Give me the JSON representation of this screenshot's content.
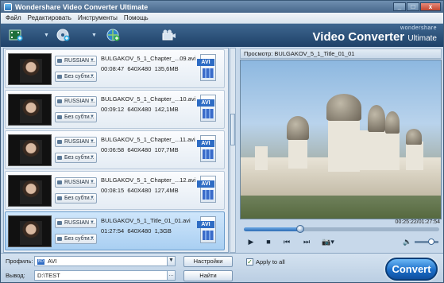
{
  "window": {
    "title": "Wondershare Video Converter Ultimate"
  },
  "menu": [
    "Файл",
    "Редактировать",
    "Инструменты",
    "Помощь"
  ],
  "brand": {
    "small": "wondershare",
    "big": "Video Converter",
    "suffix": "Ultimate"
  },
  "files": [
    {
      "name": "BULGAKOV_5_1_Chapter_...09.avi",
      "duration": "00:08:47",
      "resolution": "640X480",
      "size": "135,6MB",
      "audio": "RUSSIAN ...",
      "subtitle": "Без субти...",
      "format": "AVI",
      "selected": false
    },
    {
      "name": "BULGAKOV_5_1_Chapter_...10.avi",
      "duration": "00:09:12",
      "resolution": "640X480",
      "size": "142,1MB",
      "audio": "RUSSIAN ...",
      "subtitle": "Без субти...",
      "format": "AVI",
      "selected": false
    },
    {
      "name": "BULGAKOV_5_1_Chapter_...11.avi",
      "duration": "00:06:58",
      "resolution": "640X480",
      "size": "107,7MB",
      "audio": "RUSSIAN ...",
      "subtitle": "Без субти...",
      "format": "AVI",
      "selected": false
    },
    {
      "name": "BULGAKOV_5_1_Chapter_...12.avi",
      "duration": "00:08:15",
      "resolution": "640X480",
      "size": "127,4MB",
      "audio": "RUSSIAN ...",
      "subtitle": "Без субти...",
      "format": "AVI",
      "selected": false
    },
    {
      "name": "BULGAKOV_5_1_Title_01_01.avi",
      "duration": "01:27:54",
      "resolution": "640X480",
      "size": "1,3GB",
      "audio": "RUSSIAN ...",
      "subtitle": "Без субти...",
      "format": "AVI",
      "selected": true
    }
  ],
  "preview": {
    "title": "Просмотр: BULGAKOV_5_1_Title_01_01",
    "time": "00:25:22/01:27:54",
    "progress": 0.29,
    "volume": 0.7
  },
  "bottom": {
    "profile_label": "Профиль:",
    "profile_value": "AVI",
    "profile_icon": "BD",
    "output_label": "Вывод:",
    "output_value": "D:\\TEST",
    "settings_button": "Настройки",
    "find_button": "Найти",
    "apply_all_label": "Apply to all",
    "apply_all_checked": true,
    "convert_button": "Convert"
  }
}
